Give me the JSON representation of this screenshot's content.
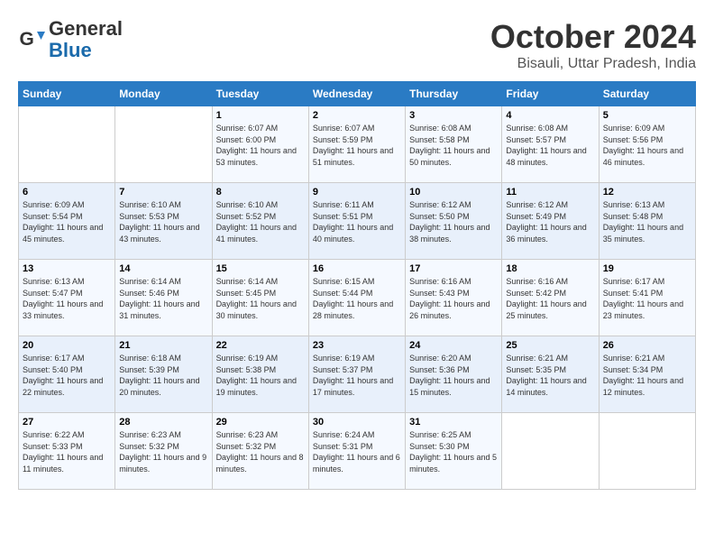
{
  "logo": {
    "text_general": "General",
    "text_blue": "Blue"
  },
  "title": "October 2024",
  "location": "Bisauli, Uttar Pradesh, India",
  "days_of_week": [
    "Sunday",
    "Monday",
    "Tuesday",
    "Wednesday",
    "Thursday",
    "Friday",
    "Saturday"
  ],
  "weeks": [
    [
      {
        "day": "",
        "detail": ""
      },
      {
        "day": "",
        "detail": ""
      },
      {
        "day": "1",
        "detail": "Sunrise: 6:07 AM\nSunset: 6:00 PM\nDaylight: 11 hours and 53 minutes."
      },
      {
        "day": "2",
        "detail": "Sunrise: 6:07 AM\nSunset: 5:59 PM\nDaylight: 11 hours and 51 minutes."
      },
      {
        "day": "3",
        "detail": "Sunrise: 6:08 AM\nSunset: 5:58 PM\nDaylight: 11 hours and 50 minutes."
      },
      {
        "day": "4",
        "detail": "Sunrise: 6:08 AM\nSunset: 5:57 PM\nDaylight: 11 hours and 48 minutes."
      },
      {
        "day": "5",
        "detail": "Sunrise: 6:09 AM\nSunset: 5:56 PM\nDaylight: 11 hours and 46 minutes."
      }
    ],
    [
      {
        "day": "6",
        "detail": "Sunrise: 6:09 AM\nSunset: 5:54 PM\nDaylight: 11 hours and 45 minutes."
      },
      {
        "day": "7",
        "detail": "Sunrise: 6:10 AM\nSunset: 5:53 PM\nDaylight: 11 hours and 43 minutes."
      },
      {
        "day": "8",
        "detail": "Sunrise: 6:10 AM\nSunset: 5:52 PM\nDaylight: 11 hours and 41 minutes."
      },
      {
        "day": "9",
        "detail": "Sunrise: 6:11 AM\nSunset: 5:51 PM\nDaylight: 11 hours and 40 minutes."
      },
      {
        "day": "10",
        "detail": "Sunrise: 6:12 AM\nSunset: 5:50 PM\nDaylight: 11 hours and 38 minutes."
      },
      {
        "day": "11",
        "detail": "Sunrise: 6:12 AM\nSunset: 5:49 PM\nDaylight: 11 hours and 36 minutes."
      },
      {
        "day": "12",
        "detail": "Sunrise: 6:13 AM\nSunset: 5:48 PM\nDaylight: 11 hours and 35 minutes."
      }
    ],
    [
      {
        "day": "13",
        "detail": "Sunrise: 6:13 AM\nSunset: 5:47 PM\nDaylight: 11 hours and 33 minutes."
      },
      {
        "day": "14",
        "detail": "Sunrise: 6:14 AM\nSunset: 5:46 PM\nDaylight: 11 hours and 31 minutes."
      },
      {
        "day": "15",
        "detail": "Sunrise: 6:14 AM\nSunset: 5:45 PM\nDaylight: 11 hours and 30 minutes."
      },
      {
        "day": "16",
        "detail": "Sunrise: 6:15 AM\nSunset: 5:44 PM\nDaylight: 11 hours and 28 minutes."
      },
      {
        "day": "17",
        "detail": "Sunrise: 6:16 AM\nSunset: 5:43 PM\nDaylight: 11 hours and 26 minutes."
      },
      {
        "day": "18",
        "detail": "Sunrise: 6:16 AM\nSunset: 5:42 PM\nDaylight: 11 hours and 25 minutes."
      },
      {
        "day": "19",
        "detail": "Sunrise: 6:17 AM\nSunset: 5:41 PM\nDaylight: 11 hours and 23 minutes."
      }
    ],
    [
      {
        "day": "20",
        "detail": "Sunrise: 6:17 AM\nSunset: 5:40 PM\nDaylight: 11 hours and 22 minutes."
      },
      {
        "day": "21",
        "detail": "Sunrise: 6:18 AM\nSunset: 5:39 PM\nDaylight: 11 hours and 20 minutes."
      },
      {
        "day": "22",
        "detail": "Sunrise: 6:19 AM\nSunset: 5:38 PM\nDaylight: 11 hours and 19 minutes."
      },
      {
        "day": "23",
        "detail": "Sunrise: 6:19 AM\nSunset: 5:37 PM\nDaylight: 11 hours and 17 minutes."
      },
      {
        "day": "24",
        "detail": "Sunrise: 6:20 AM\nSunset: 5:36 PM\nDaylight: 11 hours and 15 minutes."
      },
      {
        "day": "25",
        "detail": "Sunrise: 6:21 AM\nSunset: 5:35 PM\nDaylight: 11 hours and 14 minutes."
      },
      {
        "day": "26",
        "detail": "Sunrise: 6:21 AM\nSunset: 5:34 PM\nDaylight: 11 hours and 12 minutes."
      }
    ],
    [
      {
        "day": "27",
        "detail": "Sunrise: 6:22 AM\nSunset: 5:33 PM\nDaylight: 11 hours and 11 minutes."
      },
      {
        "day": "28",
        "detail": "Sunrise: 6:23 AM\nSunset: 5:32 PM\nDaylight: 11 hours and 9 minutes."
      },
      {
        "day": "29",
        "detail": "Sunrise: 6:23 AM\nSunset: 5:32 PM\nDaylight: 11 hours and 8 minutes."
      },
      {
        "day": "30",
        "detail": "Sunrise: 6:24 AM\nSunset: 5:31 PM\nDaylight: 11 hours and 6 minutes."
      },
      {
        "day": "31",
        "detail": "Sunrise: 6:25 AM\nSunset: 5:30 PM\nDaylight: 11 hours and 5 minutes."
      },
      {
        "day": "",
        "detail": ""
      },
      {
        "day": "",
        "detail": ""
      }
    ]
  ]
}
